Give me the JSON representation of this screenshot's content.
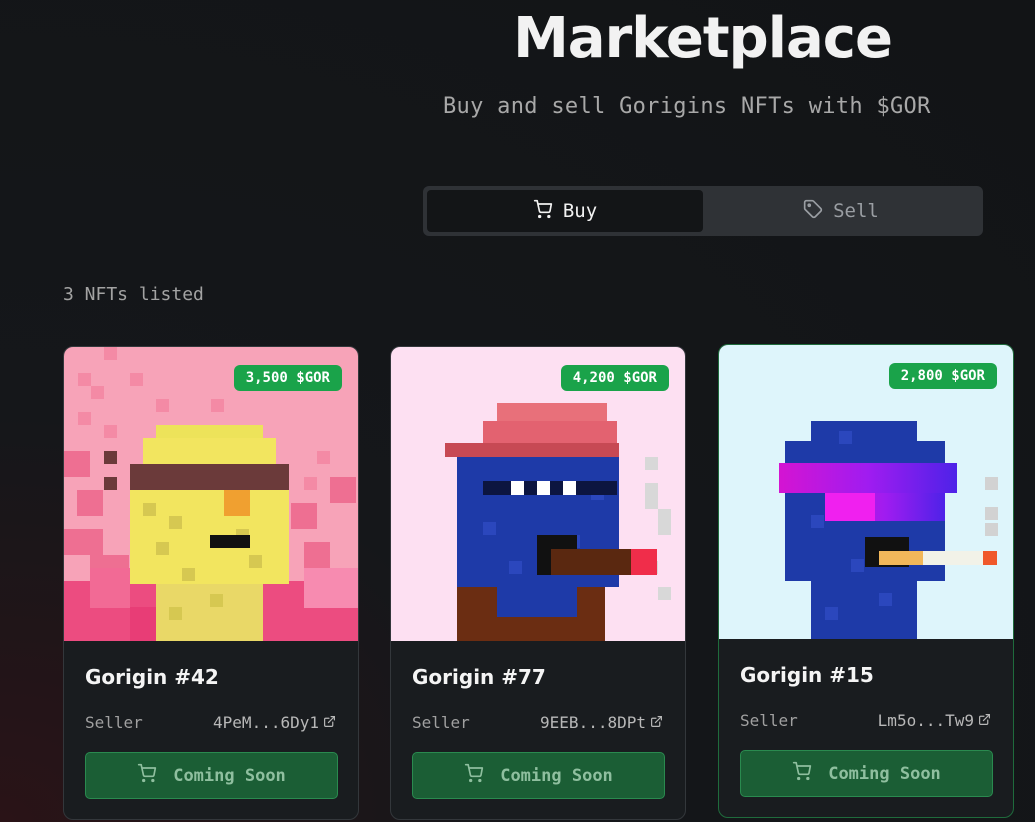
{
  "header": {
    "title": "Marketplace",
    "subtitle": "Buy and sell Gorigins NFTs with $GOR"
  },
  "tabs": [
    {
      "label": "Buy",
      "icon": "cart-icon",
      "active": true
    },
    {
      "label": "Sell",
      "icon": "tag-icon",
      "active": false
    }
  ],
  "listing_count": "3 NFTs listed",
  "cards": [
    {
      "name": "Gorigin #42",
      "price": "3,500 $GOR",
      "seller_label": "Seller",
      "seller": "4PeM...6Dy1",
      "button": "Coming Soon",
      "bg": "#f7a3b8"
    },
    {
      "name": "Gorigin #77",
      "price": "4,200 $GOR",
      "seller_label": "Seller",
      "seller": "9EEB...8DPt",
      "button": "Coming Soon",
      "bg": "#fde0f2"
    },
    {
      "name": "Gorigin #15",
      "price": "2,800 $GOR",
      "seller_label": "Seller",
      "seller": "Lm5o...Tw9",
      "button": "Coming Soon",
      "bg": "#def5fb"
    }
  ],
  "colors": {
    "accent_green": "#1aa34a",
    "button_green": "#1b5e35",
    "background": "#121416"
  }
}
